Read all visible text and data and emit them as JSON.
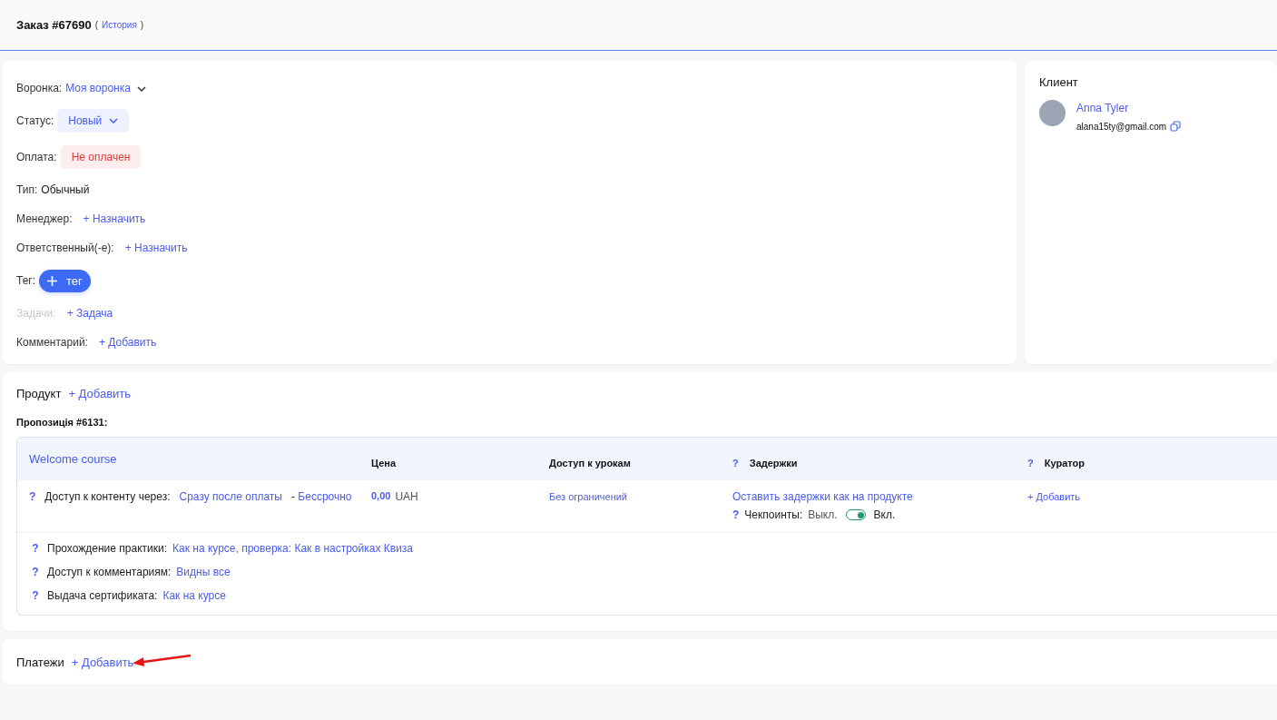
{
  "header": {
    "title": "Заказ #67690",
    "history_open": "(",
    "history_link": "История",
    "history_close": ")"
  },
  "order_fields": [
    {
      "label": "Воронка:",
      "value": "Моя воронка",
      "kind": "dropdown",
      "disabled": false
    },
    {
      "label": "Статус:",
      "value": "Новый",
      "kind": "status",
      "disabled": false
    },
    {
      "label": "Оплата:",
      "value": "Не оплачен",
      "kind": "badge",
      "disabled": false
    },
    {
      "label": "Тип:",
      "value": "Обычный",
      "kind": "text",
      "disabled": false
    },
    {
      "label": "Менеджер:",
      "value": "+ Назначить",
      "kind": "link",
      "disabled": false
    },
    {
      "label": "Ответственный(-е):",
      "value": "+ Назначить",
      "kind": "link",
      "disabled": false
    },
    {
      "label": "Тег:",
      "value": "тег",
      "kind": "tag",
      "disabled": false
    },
    {
      "label": "Задачи:",
      "value": "+ Задача",
      "kind": "link",
      "disabled": true
    },
    {
      "label": "Комментарий:",
      "value": "+ Добавить",
      "kind": "link",
      "disabled": false
    }
  ],
  "client": {
    "title": "Клиент",
    "name": "Anna Tyler",
    "email": "alana15ty@gmail.com"
  },
  "product": {
    "title": "Продукт",
    "add": "+ Добавить",
    "proposition": "Пропозиція #6131:",
    "table": {
      "course": "Welcome course",
      "columns": [
        {
          "label": "Цена"
        },
        {
          "label": "Доступ к урокам"
        },
        {
          "label": "Задержки",
          "help": "?"
        },
        {
          "label": "Куратор",
          "help": "?"
        }
      ],
      "access": {
        "help": "?",
        "label": "Доступ к контенту через:",
        "value": "Сразу после оплаты",
        "separator": "-",
        "duration": "Бессрочно"
      },
      "price": {
        "amount": "0,00",
        "currency": "UAH"
      },
      "lessons_access": "Без ограничений",
      "delays": {
        "value": "Оставить задержки как на продукте",
        "checkpoints": {
          "help": "?",
          "label": "Чекпоинты:",
          "off_label": "Выкл.",
          "on_label": "Вкл.",
          "on": true
        }
      },
      "curator": "+ Добавить",
      "settings": [
        {
          "help": "?",
          "label": "Прохождение практики:",
          "value": "Как на курсе, проверка: Как в настройках Квиза"
        },
        {
          "help": "?",
          "label": "Доступ к комментариям:",
          "value": "Видны все"
        },
        {
          "help": "?",
          "label": "Выдача сертификата:",
          "value": "Как на курсе"
        }
      ]
    }
  },
  "payments": {
    "title": "Платежи",
    "add": "+ Добавить"
  }
}
